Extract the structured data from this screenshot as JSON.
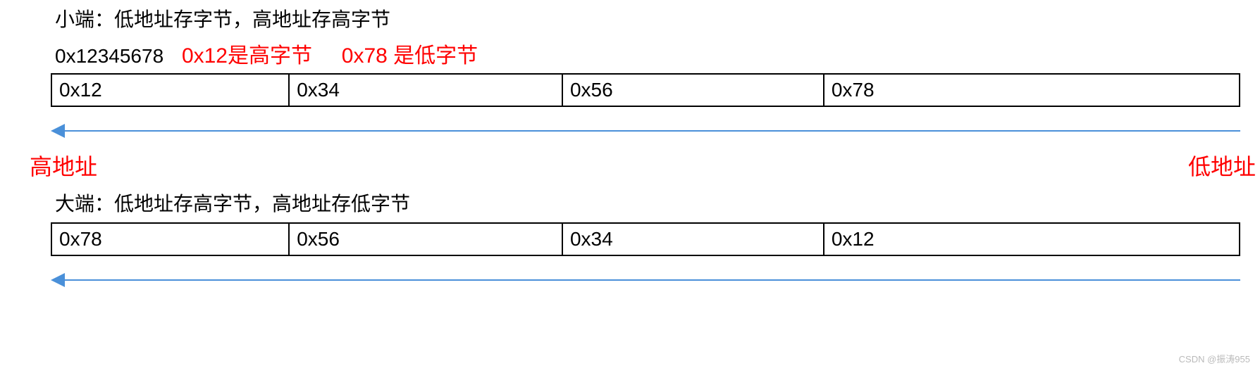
{
  "little_endian": {
    "desc": "小端：低地址存字节，高地址存高字节",
    "hex_value": "0x12345678",
    "note_high": "0x12是高字节",
    "note_low": "0x78 是低字节",
    "cells": [
      "0x12",
      "0x34",
      "0x56",
      "0x78"
    ]
  },
  "addr": {
    "left": "高地址",
    "right": "低地址"
  },
  "big_endian": {
    "desc": "大端：低地址存高字节，高地址存低字节",
    "cells": [
      "0x78",
      "0x56",
      "0x34",
      "0x12"
    ]
  },
  "watermark": "CSDN @振涛955"
}
